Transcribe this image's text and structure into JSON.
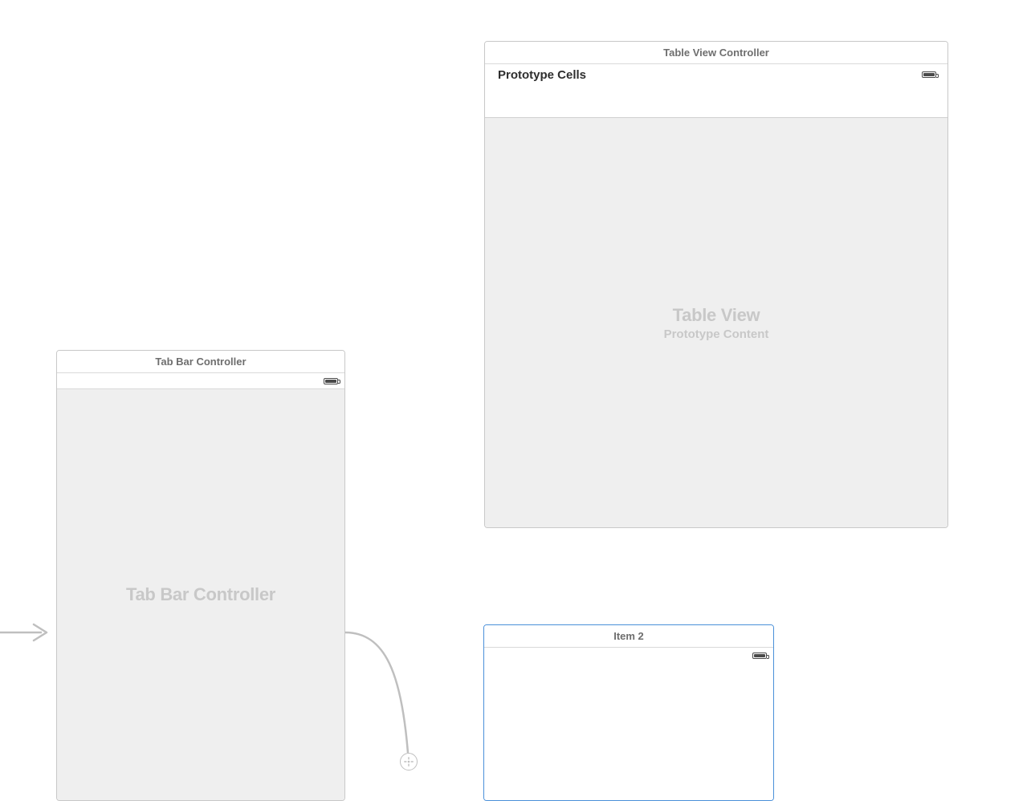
{
  "scenes": {
    "tabBar": {
      "title": "Tab Bar Controller",
      "placeholder": "Tab Bar Controller"
    },
    "tableView": {
      "title": "Table View Controller",
      "prototypeLabel": "Prototype Cells",
      "placeholder": "Table View",
      "placeholderSub": "Prototype Content"
    },
    "item2": {
      "title": "Item 2"
    }
  }
}
